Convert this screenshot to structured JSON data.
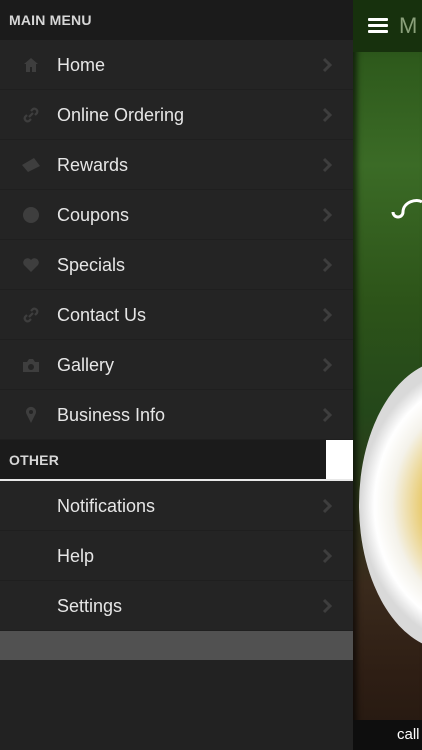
{
  "main_menu": {
    "header": "MAIN MENU",
    "items": [
      {
        "label": "Home",
        "icon": "home-icon"
      },
      {
        "label": "Online Ordering",
        "icon": "link-icon"
      },
      {
        "label": "Rewards",
        "icon": "ticket-icon"
      },
      {
        "label": "Coupons",
        "icon": "circle-icon"
      },
      {
        "label": "Specials",
        "icon": "heart-icon"
      },
      {
        "label": "Contact Us",
        "icon": "link-icon"
      },
      {
        "label": "Gallery",
        "icon": "camera-icon"
      },
      {
        "label": "Business Info",
        "icon": "location-pin-icon"
      }
    ]
  },
  "other_menu": {
    "header": "OTHER",
    "items": [
      {
        "label": "Notifications"
      },
      {
        "label": "Help"
      },
      {
        "label": "Settings"
      }
    ]
  },
  "right_panel": {
    "title_fragment": "M",
    "call_fragment": "call"
  },
  "colors": {
    "drawer_bg": "#222222",
    "header_bg": "#1b1b1b",
    "text": "#e6e6e6",
    "icon": "#3e3e3e",
    "accent_green": "#2e5a1c"
  }
}
